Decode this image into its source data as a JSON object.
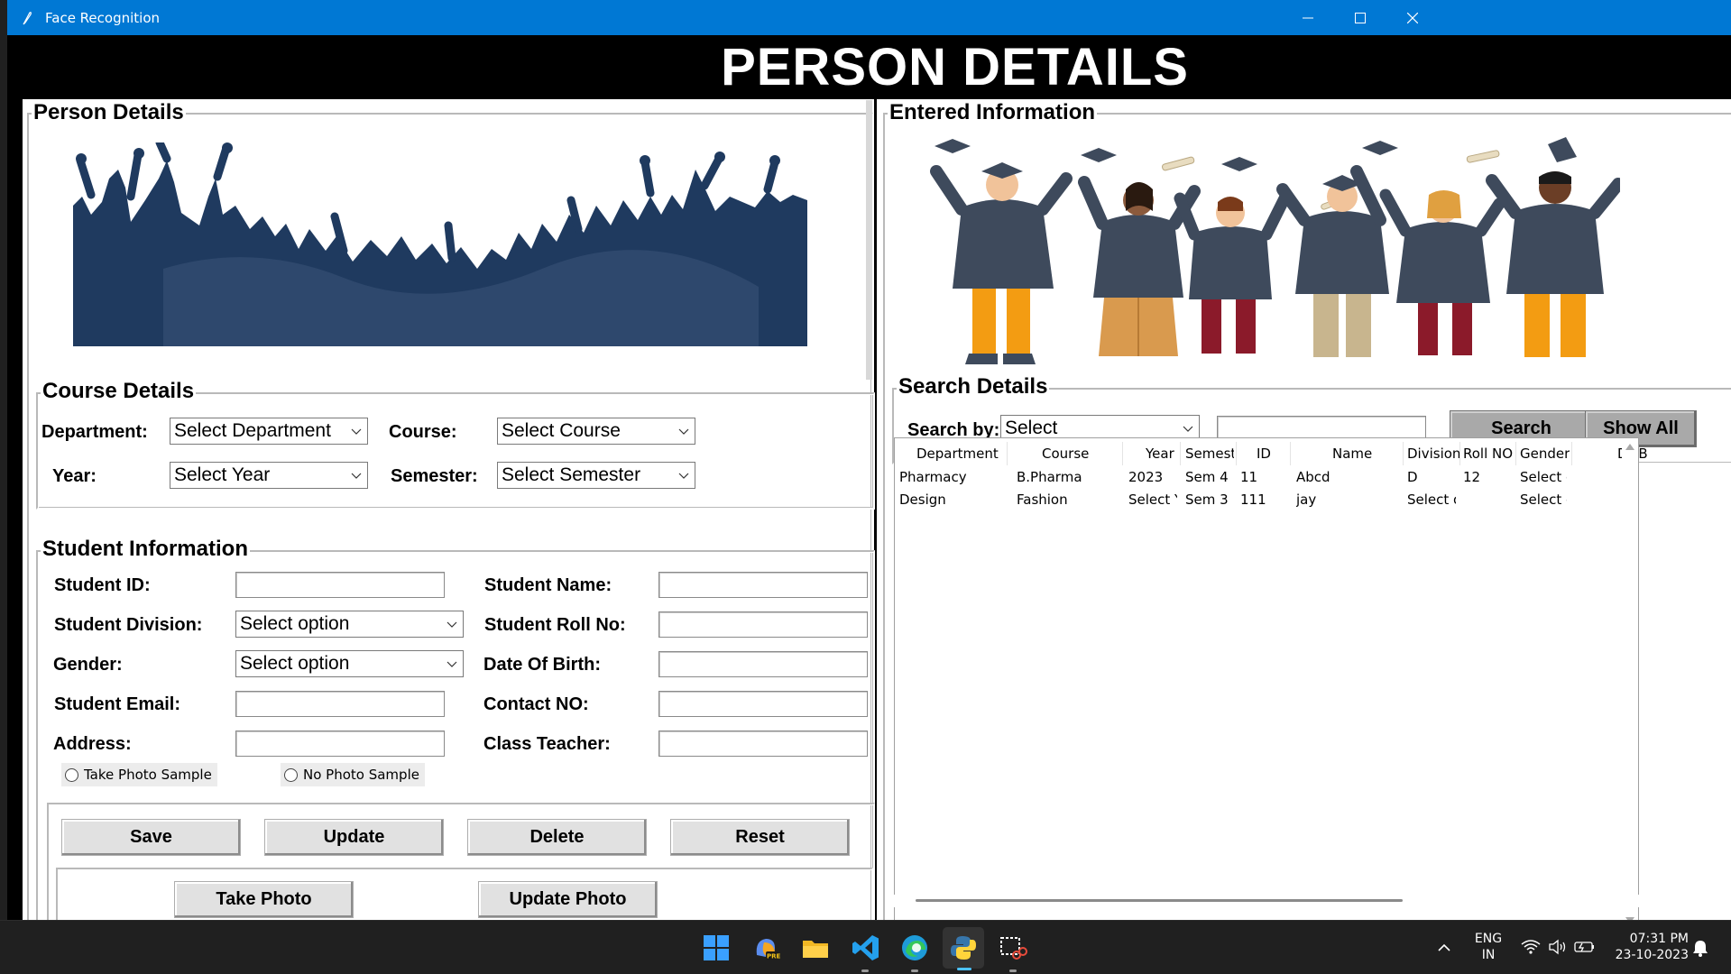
{
  "window": {
    "title": "Face Recognition"
  },
  "banner": "PERSON DETAILS",
  "left": {
    "frame_title": "Person Details",
    "course": {
      "frame_title": "Course Details",
      "department_label": "Department:",
      "department_value": "Select Department",
      "course_label": "Course:",
      "course_value": "Select Course",
      "year_label": "Year:",
      "year_value": "Select Year",
      "semester_label": "Semester:",
      "semester_value": "Select Semester"
    },
    "student": {
      "frame_title": "Student Information",
      "id_label": "Student ID:",
      "name_label": "Student Name:",
      "division_label": "Student Division:",
      "division_value": "Select option",
      "roll_label": "Student Roll No:",
      "gender_label": "Gender:",
      "gender_value": "Select option",
      "dob_label": "Date Of Birth:",
      "email_label": "Student Email:",
      "contact_label": "Contact NO:",
      "address_label": "Address:",
      "teacher_label": "Class Teacher:",
      "radio_take": "Take Photo Sample",
      "radio_none": "No Photo Sample"
    },
    "buttons": {
      "save": "Save",
      "update": "Update",
      "delete": "Delete",
      "reset": "Reset",
      "take_photo": "Take Photo",
      "update_photo": "Update Photo"
    }
  },
  "right": {
    "frame_title": "Entered Information",
    "search": {
      "frame_title": "Search Details",
      "label": "Search by:",
      "combo_value": "Select",
      "search_button": "Search",
      "show_all_button": "Show All"
    },
    "table": {
      "columns": [
        "Department",
        "Course",
        "Year",
        "Semeste",
        "ID",
        "Name",
        "Division",
        "Roll NO",
        "Gender",
        "DOB"
      ],
      "rows": [
        [
          "Pharmacy",
          "B.Pharma",
          "2023",
          "Sem 4",
          "11",
          "Abcd",
          "D",
          "12",
          "Select o",
          ""
        ],
        [
          "Design",
          "Fashion",
          "Select Y",
          "Sem 3",
          "111",
          "jay",
          "Select o",
          "",
          "Select o",
          ""
        ]
      ]
    }
  },
  "taskbar": {
    "lang_top": "ENG",
    "lang_bottom": "IN",
    "time": "07:31 PM",
    "date": "23-10-2023",
    "icons": [
      "windows-start-icon",
      "copilot-icon",
      "file-explorer-icon",
      "vscode-icon",
      "edge-icon",
      "python-icon",
      "snipping-tool-icon"
    ]
  },
  "colors": {
    "titlebar": "#0078d4",
    "crowd": "#1f3a5f",
    "gown": "#3e4a5c",
    "accent_orange": "#f39c12"
  }
}
